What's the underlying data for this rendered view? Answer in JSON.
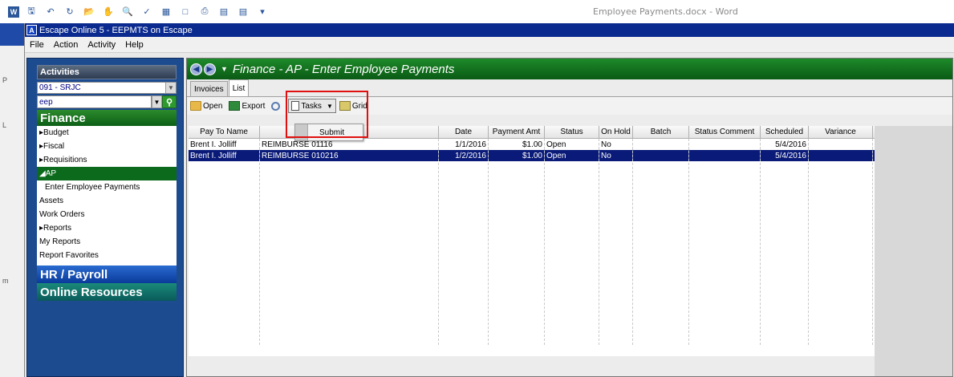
{
  "word": {
    "logo": "W",
    "title": "Employee Payments.docx - Word"
  },
  "app": {
    "logo": "A",
    "title": "Escape Online 5 - EEPMTS on Escape",
    "menu": [
      "File",
      "Action",
      "Activity",
      "Help"
    ]
  },
  "sidebar": {
    "activities_label": "Activities",
    "district_value": "091 - SRJC",
    "search_value": "eep",
    "finance": {
      "label": "Finance",
      "items": [
        {
          "label": "▸Budget"
        },
        {
          "label": "▸Fiscal"
        },
        {
          "label": "▸Requisitions"
        },
        {
          "label": "◢AP"
        },
        {
          "label": "Enter Employee Payments"
        },
        {
          "label": "Assets"
        },
        {
          "label": "Work Orders"
        },
        {
          "label": "▸Reports"
        },
        {
          "label": "My Reports"
        },
        {
          "label": "Report Favorites"
        }
      ]
    },
    "hr_label": "HR / Payroll",
    "online_label": "Online Resources"
  },
  "main": {
    "title": "Finance - AP - Enter Employee Payments",
    "tabs": [
      "Invoices",
      "List"
    ],
    "toolbar": {
      "open": "Open",
      "export": "Export",
      "tasks": "Tasks",
      "grid": "Grid"
    },
    "popup": {
      "item": "Submit"
    },
    "table": {
      "headers": [
        "Pay To Name",
        "",
        "Date",
        "Payment Amt",
        "Status",
        "On Hold",
        "Batch",
        "Status Comment",
        "Scheduled",
        "Variance"
      ],
      "rows": [
        [
          "Brent I. Jolliff",
          "REIMBURSE 01116",
          "1/1/2016",
          "$1.00",
          "Open",
          "No",
          "",
          "",
          "5/4/2016",
          ""
        ],
        [
          "Brent I. Jolliff",
          "REIMBURSE 010216",
          "1/2/2016",
          "$1.00",
          "Open",
          "No",
          "",
          "",
          "5/4/2016",
          ""
        ]
      ],
      "selected_row": 1
    }
  },
  "gutter": {
    "marks": [
      "P",
      "L",
      "m"
    ]
  }
}
